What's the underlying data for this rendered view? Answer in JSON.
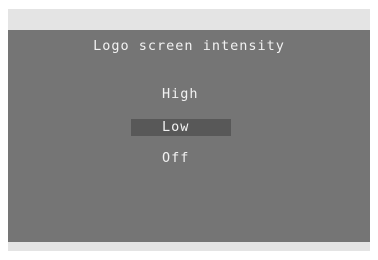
{
  "menu": {
    "title": "Logo screen intensity",
    "options": [
      {
        "label": "High",
        "selected": false
      },
      {
        "label": "Low",
        "selected": true
      },
      {
        "label": "Off",
        "selected": false
      }
    ]
  },
  "colors": {
    "screen_background": "#757575",
    "frame_background": "#e4e4e4",
    "selection_highlight": "#585858",
    "text": "#f2f2f2"
  }
}
